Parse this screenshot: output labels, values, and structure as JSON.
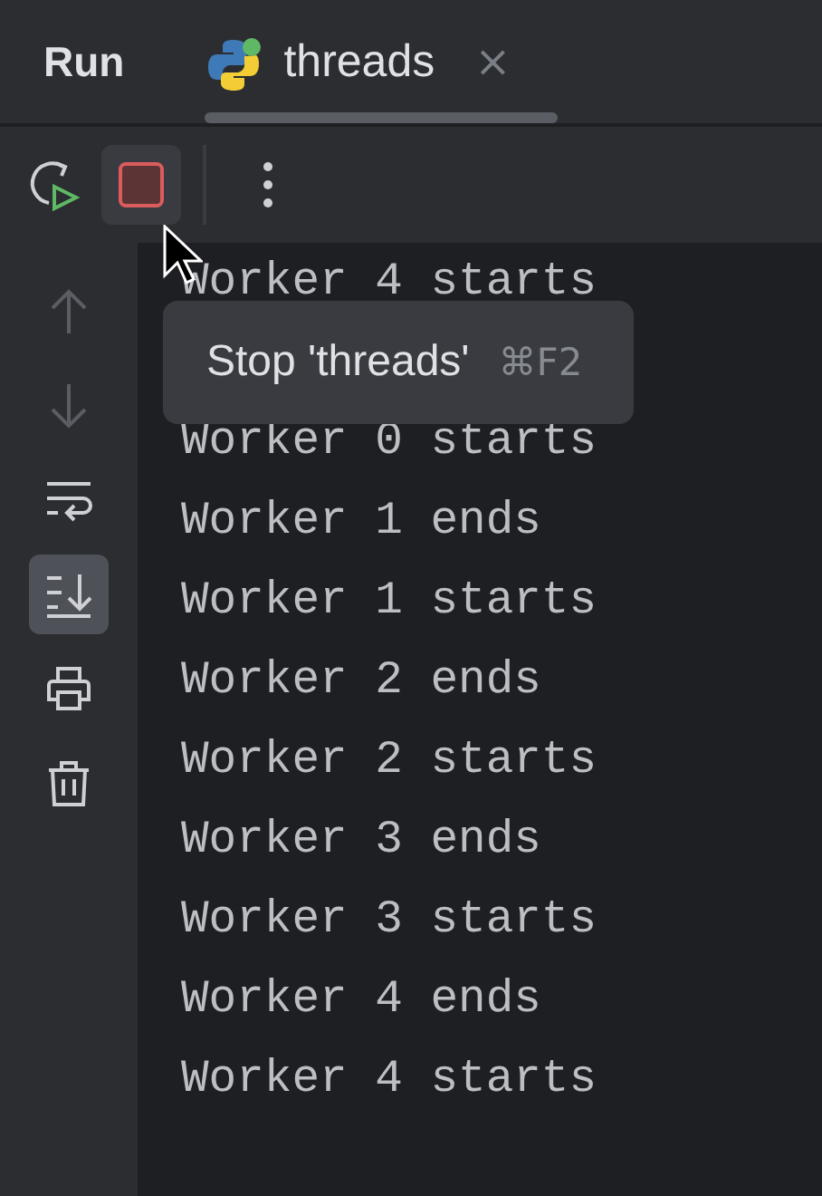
{
  "header": {
    "title": "Run"
  },
  "tabs": [
    {
      "label": "threads",
      "selected": true,
      "close": "×"
    }
  ],
  "toolbar": [
    {
      "kind": "rerun",
      "hovered": false
    },
    {
      "kind": "stop",
      "hovered": true
    },
    {
      "kind": "divider"
    },
    {
      "kind": "more",
      "hovered": false
    }
  ],
  "sidebar": {
    "tools": [
      {
        "kind": "up",
        "disabled": true,
        "selected": false
      },
      {
        "kind": "down",
        "disabled": true,
        "selected": false
      },
      {
        "kind": "wrap",
        "disabled": false,
        "selected": false
      },
      {
        "kind": "scroll-end",
        "disabled": false,
        "selected": true
      },
      {
        "kind": "print",
        "disabled": false,
        "selected": false
      },
      {
        "kind": "trash",
        "disabled": false,
        "selected": false
      }
    ]
  },
  "console": {
    "lines": [
      "Worker 4 starts",
      "Worker 0 starts",
      "Worker 1 ends",
      "Worker 1 starts",
      "Worker 2 ends",
      "Worker 2 starts",
      "Worker 3 ends",
      "Worker 3 starts",
      "Worker 4 ends",
      "Worker 4 starts"
    ]
  },
  "tooltip": {
    "text": "Stop 'threads'",
    "shortcut": "⌘F2"
  }
}
